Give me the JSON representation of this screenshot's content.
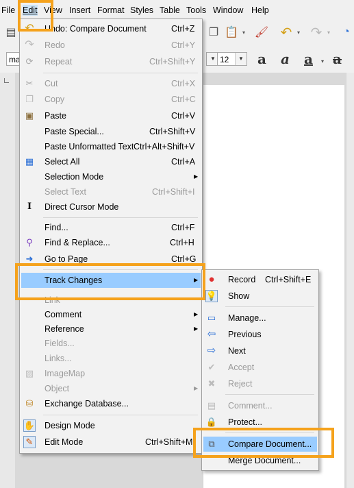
{
  "menubar": {
    "items": [
      "File",
      "Edit",
      "View",
      "Insert",
      "Format",
      "Styles",
      "Table",
      "Tools",
      "Window",
      "Help"
    ]
  },
  "toolbar": {
    "paragraph_style": "ma",
    "font_size": "12"
  },
  "edit_menu": {
    "items": [
      {
        "label": "Undo: Compare Document",
        "shortcut": "Ctrl+Z",
        "icon": "undo-icon"
      },
      {
        "label": "Redo",
        "shortcut": "Ctrl+Y",
        "icon": "redo-icon"
      },
      {
        "label": "Repeat",
        "shortcut": "Ctrl+Shift+Y",
        "icon": "repeat-icon"
      },
      {
        "label": "Cut",
        "shortcut": "Ctrl+X",
        "icon": "scissors-icon"
      },
      {
        "label": "Copy",
        "shortcut": "Ctrl+C",
        "icon": "copy-icon"
      },
      {
        "label": "Paste",
        "shortcut": "Ctrl+V",
        "icon": "paste-icon"
      },
      {
        "label": "Paste Special...",
        "shortcut": "Ctrl+Shift+V"
      },
      {
        "label": "Paste Unformatted Text",
        "shortcut": "Ctrl+Alt+Shift+V"
      },
      {
        "label": "Select All",
        "shortcut": "Ctrl+A",
        "icon": "select-all-icon"
      },
      {
        "label": "Selection Mode"
      },
      {
        "label": "Select Text",
        "shortcut": "Ctrl+Shift+I"
      },
      {
        "label": "Direct Cursor Mode",
        "icon": "text-cursor-icon"
      },
      {
        "label": "Find...",
        "shortcut": "Ctrl+F"
      },
      {
        "label": "Find & Replace...",
        "shortcut": "Ctrl+H",
        "icon": "find-replace-icon"
      },
      {
        "label": "Go to Page",
        "shortcut": "Ctrl+G",
        "icon": "go-to-page-icon"
      },
      {
        "label": "Track Changes"
      },
      {
        "label": "Link"
      },
      {
        "label": "Comment"
      },
      {
        "label": "Reference"
      },
      {
        "label": "Fields..."
      },
      {
        "label": "Links..."
      },
      {
        "label": "ImageMap",
        "icon": "image-map-icon"
      },
      {
        "label": "Object"
      },
      {
        "label": "Exchange Database...",
        "icon": "database-icon"
      },
      {
        "label": "Design Mode",
        "icon": "design-mode-icon"
      },
      {
        "label": "Edit Mode",
        "shortcut": "Ctrl+Shift+M",
        "icon": "edit-mode-icon"
      }
    ]
  },
  "track_changes_menu": {
    "items": [
      {
        "label": "Record",
        "shortcut": "Ctrl+Shift+E",
        "icon": "record-icon"
      },
      {
        "label": "Show",
        "icon": "show-changes-icon"
      },
      {
        "label": "Manage...",
        "icon": "manage-icon"
      },
      {
        "label": "Previous",
        "icon": "arrow-left-icon"
      },
      {
        "label": "Next",
        "icon": "arrow-right-icon"
      },
      {
        "label": "Accept",
        "icon": "checkmark-icon"
      },
      {
        "label": "Reject",
        "icon": "reject-icon"
      },
      {
        "label": "Comment...",
        "icon": "comment-icon"
      },
      {
        "label": "Protect...",
        "icon": "lock-icon"
      },
      {
        "label": "Compare Document...",
        "icon": "compare-document-icon"
      },
      {
        "label": "Merge Document..."
      }
    ]
  },
  "colors": {
    "highlight_box": "#f5a21c",
    "selected_item": "#99ccff",
    "record_dot": "#e03030",
    "arrow_blue": "#2b6fd6"
  }
}
